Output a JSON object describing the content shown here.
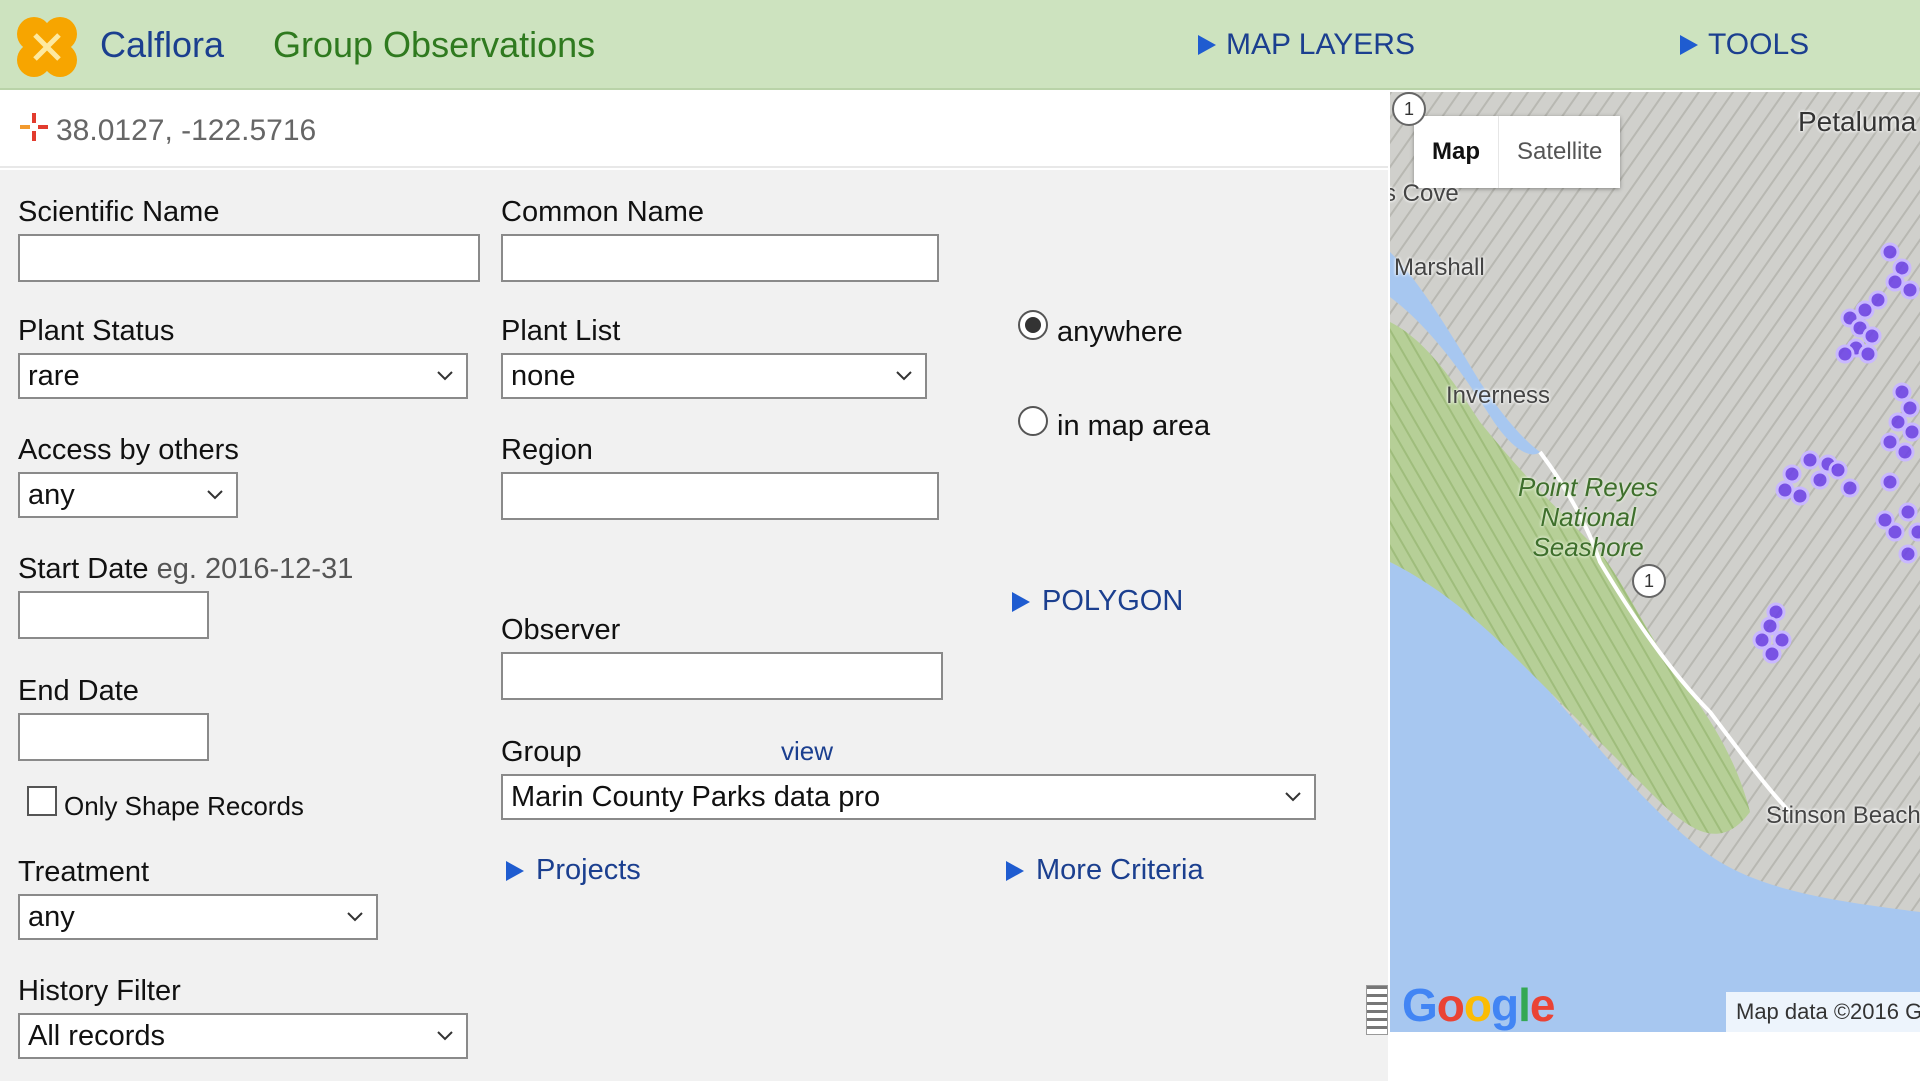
{
  "header": {
    "app_name": "Calflora",
    "page_title": "Group Observations",
    "menu_map_layers": "MAP LAYERS",
    "menu_tools": "TOOLS"
  },
  "location": {
    "coordinates": "38.0127, -122.5716"
  },
  "form": {
    "scientific_name": {
      "label": "Scientific Name",
      "value": ""
    },
    "common_name": {
      "label": "Common Name",
      "value": ""
    },
    "plant_status": {
      "label": "Plant Status",
      "value": "rare"
    },
    "plant_list": {
      "label": "Plant List",
      "value": "none"
    },
    "location_scope": {
      "options": [
        {
          "label": "anywhere",
          "checked": true
        },
        {
          "label": "in map area",
          "checked": false
        }
      ]
    },
    "access_by_others": {
      "label": "Access by others",
      "value": "any"
    },
    "region": {
      "label": "Region",
      "value": ""
    },
    "start_date": {
      "label": "Start Date",
      "hint": "eg. 2016-12-31",
      "value": ""
    },
    "polygon_label": "POLYGON",
    "observer": {
      "label": "Observer",
      "value": ""
    },
    "end_date": {
      "label": "End Date",
      "value": ""
    },
    "group": {
      "label": "Group",
      "view_link": "view",
      "value": "Marin County Parks data pro"
    },
    "only_shape_records": {
      "label": "Only Shape Records",
      "checked": false
    },
    "treatment": {
      "label": "Treatment",
      "value": "any"
    },
    "projects_label": "Projects",
    "more_criteria_label": "More Criteria",
    "history_filter": {
      "label": "History Filter",
      "value": "All records"
    }
  },
  "map": {
    "type_buttons": [
      "Map",
      "Satellite"
    ],
    "active_type": "Map",
    "places": [
      "Petaluma",
      "s Cove",
      "Marshall",
      "Inverness",
      "Stinson Beach"
    ],
    "park_label": [
      "Point Reyes",
      "National",
      "Seashore"
    ],
    "route_shields": [
      "1",
      "1"
    ],
    "attribution": "Map data ©2016 G",
    "provider_logo": "Google",
    "marker_color": "#6a3de8"
  },
  "colors": {
    "header_bg": "#cde3bf",
    "brand_blue": "#1b3f8f",
    "title_green": "#2f7a1f",
    "accent_blue": "#1f5cd0",
    "logo_orange": "#f7a500"
  }
}
